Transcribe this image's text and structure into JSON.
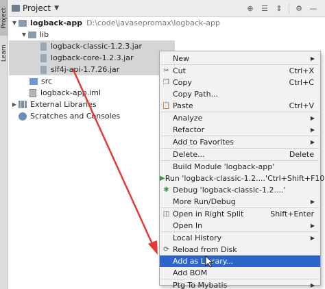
{
  "toolstrip": {
    "project_label": "Project",
    "learn_label": "Learn"
  },
  "header": {
    "title": "Project"
  },
  "tree": {
    "root": {
      "name": "logback-app",
      "path": "D:\\code\\javasepromax\\logback-app"
    },
    "lib": "lib",
    "jars": [
      "logback-classic-1.2.3.jar",
      "logback-core-1.2.3.jar",
      "slf4j-api-1.7.26.jar"
    ],
    "src": "src",
    "iml": "logback-app.iml",
    "external": "External Libraries",
    "scratches": "Scratches and Consoles"
  },
  "menu": {
    "new": "New",
    "cut": "Cut",
    "cut_sc": "Ctrl+X",
    "copy": "Copy",
    "copy_sc": "Ctrl+C",
    "copy_path": "Copy Path...",
    "paste": "Paste",
    "paste_sc": "Ctrl+V",
    "analyze": "Analyze",
    "refactor": "Refactor",
    "add_favorites": "Add to Favorites",
    "delete": "Delete...",
    "delete_sc": "Delete",
    "build_module": "Build Module 'logback-app'",
    "run": "Run 'logback-classic-1.2....'",
    "run_sc": "Ctrl+Shift+F10",
    "debug": "Debug 'logback-classic-1.2....'",
    "more_run": "More Run/Debug",
    "open_split": "Open in Right Split",
    "open_split_sc": "Shift+Enter",
    "open_in": "Open In",
    "local_history": "Local History",
    "reload": "Reload from Disk",
    "add_library": "Add as Library...",
    "add_bom": "Add BOM",
    "ptg": "Ptg To Mybatis"
  },
  "colors": {
    "highlight": "#2f65ca",
    "annotation_arrow": "#e53935"
  }
}
